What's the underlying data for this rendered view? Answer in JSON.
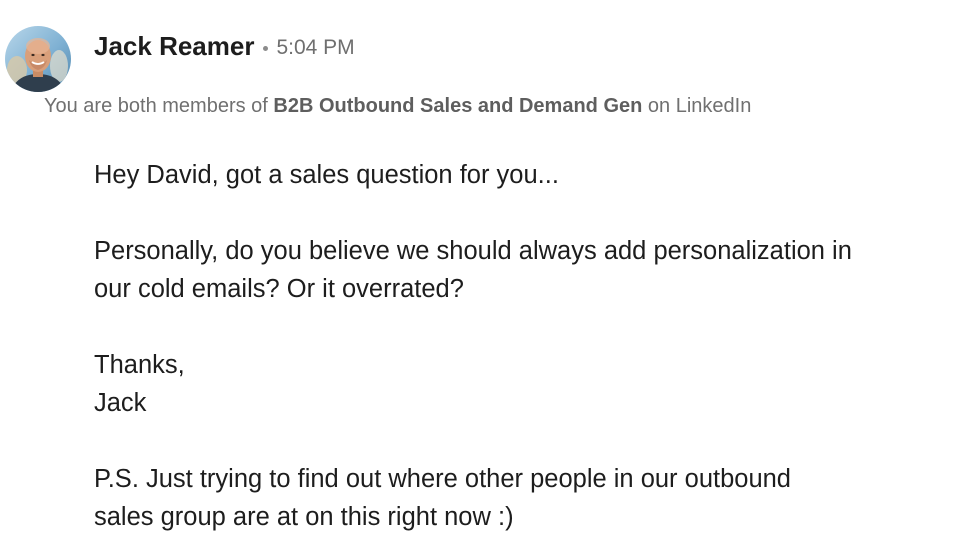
{
  "message": {
    "sender": {
      "name": "Jack Reamer",
      "time": "5:04 PM"
    },
    "context": {
      "prefix": "You are both members of",
      "group": "B2B Outbound Sales and Demand Gen",
      "suffix": "on LinkedIn"
    },
    "body": {
      "greeting": "Hey David, got a sales question for you...",
      "question_line1": "Personally, do you believe we should always add personalization in",
      "question_line2": "our cold emails? Or it overrated?",
      "signoff": "Thanks,",
      "signature": "Jack",
      "ps_line1": "P.S. Just trying to find out where other people in our outbound",
      "ps_line2": "sales group are at on this right now :)"
    }
  },
  "colors": {
    "text": "#1d1d1d",
    "muted": "#707070",
    "avatar_bg": "#8cb8d6"
  },
  "icons": {
    "avatar": "profile-photo"
  }
}
